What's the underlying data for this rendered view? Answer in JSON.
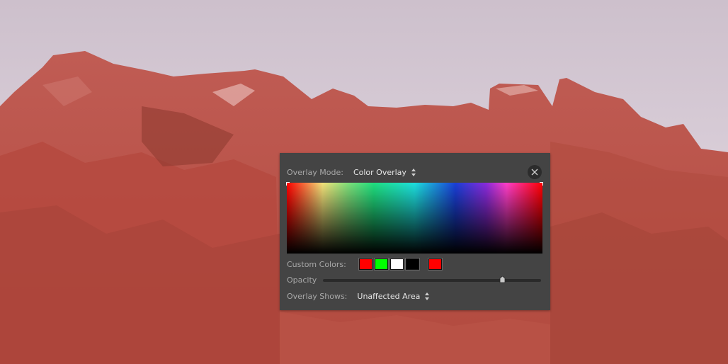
{
  "panel": {
    "overlay_mode_label": "Overlay Mode:",
    "overlay_mode_value": "Color Overlay",
    "custom_colors_label": "Custom Colors:",
    "custom_colors": [
      "#ff0000",
      "#00ff00",
      "#ffffff",
      "#000000"
    ],
    "current_color": "#ff0000",
    "opacity_label": "Opacity",
    "opacity_value": 0.82,
    "overlay_shows_label": "Overlay Shows:",
    "overlay_shows_value": "Unaffected Area"
  },
  "icons": {
    "close": "close-icon",
    "mode_stepper": "up-down-stepper-icon",
    "shows_stepper": "up-down-stepper-icon"
  },
  "colors": {
    "panel_bg": "#444444",
    "overlay_tint": "#b84a40"
  }
}
